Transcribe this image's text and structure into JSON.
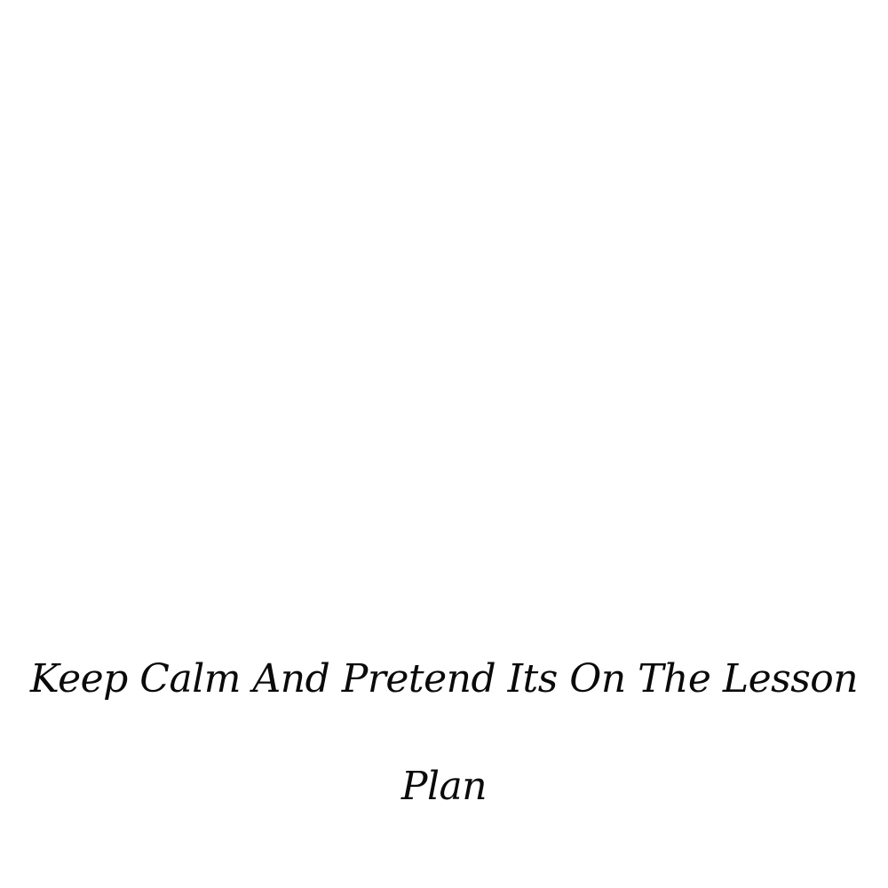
{
  "quote": {
    "line1": "Keep Calm And Pretend Its On The Lesson",
    "line2": "Plan"
  },
  "colors": {
    "background": "#ffffff",
    "text": "#0a0a0a"
  }
}
